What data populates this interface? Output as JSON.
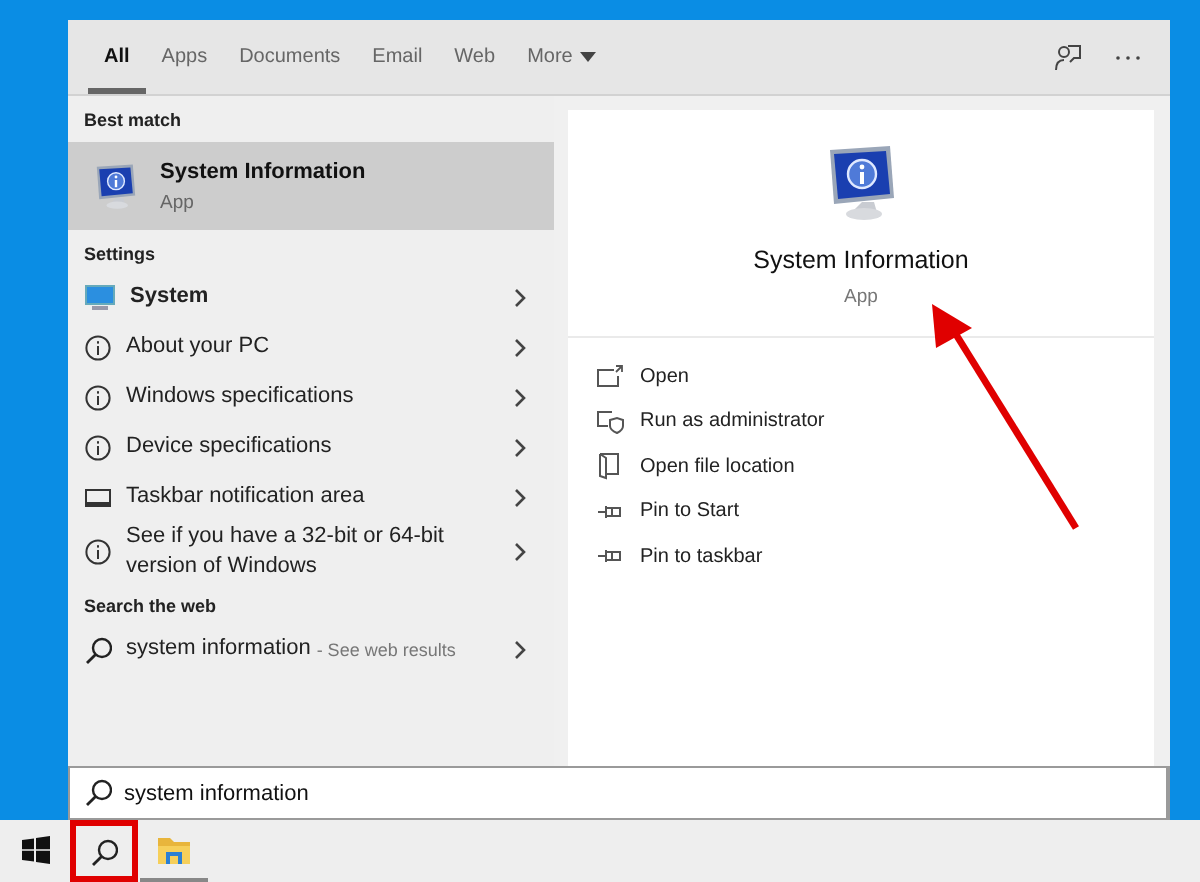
{
  "tabs": [
    {
      "label": "All",
      "selected": true,
      "kind": "plain"
    },
    {
      "label": "Apps",
      "selected": false,
      "kind": "plain"
    },
    {
      "label": "Documents",
      "selected": false,
      "kind": "plain"
    },
    {
      "label": "Email",
      "selected": false,
      "kind": "plain"
    },
    {
      "label": "Web",
      "selected": false,
      "kind": "plain"
    },
    {
      "label": "More",
      "selected": false,
      "kind": "menu"
    }
  ],
  "best_match": {
    "heading": "Best match",
    "title": "System Information",
    "subtitle": "App",
    "selected": true
  },
  "settings": {
    "heading": "Settings",
    "items": [
      {
        "label": "System",
        "kind": "display",
        "bold": true
      },
      {
        "label": "About your PC",
        "kind": "info",
        "bold": false
      },
      {
        "label": "Windows specifications",
        "kind": "info",
        "bold": false
      },
      {
        "label": "Device specifications",
        "kind": "info",
        "bold": false
      },
      {
        "label": "Taskbar notification area",
        "kind": "taskbar",
        "bold": false
      },
      {
        "label": "See if you have a 32-bit or 64-bit version of Windows",
        "kind": "info",
        "bold": false
      }
    ]
  },
  "web": {
    "heading": "Search the web",
    "query": "system information",
    "hint": "- See web results"
  },
  "preview": {
    "title": "System Information",
    "subtitle": "App",
    "actions": [
      {
        "label": "Open",
        "kind": "open"
      },
      {
        "label": "Run as administrator",
        "kind": "admin"
      },
      {
        "label": "Open file location",
        "kind": "folder"
      },
      {
        "label": "Pin to Start",
        "kind": "pin"
      },
      {
        "label": "Pin to taskbar",
        "kind": "pin"
      }
    ]
  },
  "search_box": {
    "value": "system information"
  },
  "taskbar": [
    {
      "kind": "start",
      "running": false,
      "highlighted": false
    },
    {
      "kind": "search",
      "running": false,
      "highlighted": true
    },
    {
      "kind": "explorer",
      "running": true,
      "highlighted": false
    }
  ],
  "annotation_arrow": true
}
